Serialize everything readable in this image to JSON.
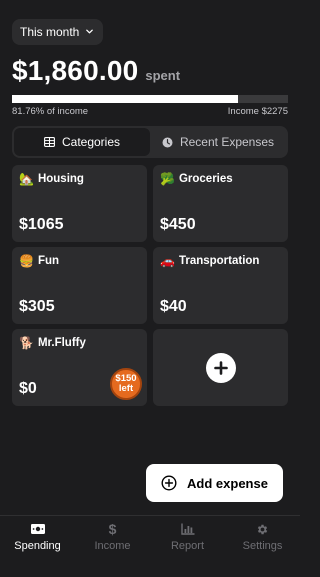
{
  "period": {
    "label": "This month",
    "icon": "chevron-down-icon"
  },
  "summary": {
    "amount": "$1,860.00",
    "spent_label": "spent",
    "progress": 0.8176,
    "percent_of_income": "81.76% of income",
    "income": "Income $2275"
  },
  "tabs": [
    {
      "label": "Categories",
      "icon": "table-icon",
      "active": true
    },
    {
      "label": "Recent Expenses",
      "icon": "clock-icon",
      "active": false
    }
  ],
  "categories": [
    {
      "emoji": "🏡",
      "name": "Housing",
      "amount": "$1065"
    },
    {
      "emoji": "🥦",
      "name": "Groceries",
      "amount": "$450"
    },
    {
      "emoji": "🍔",
      "name": "Fun",
      "amount": "$305"
    },
    {
      "emoji": "🚗",
      "name": "Transportation",
      "amount": "$40"
    },
    {
      "emoji": "🐕",
      "name": "Mr.Fluffy",
      "amount": "$0",
      "badge_amount": "$150",
      "badge_label": "left"
    }
  ],
  "add_category_icon": "plus-icon",
  "add_expense": {
    "label": "Add expense",
    "icon": "plus-circle-icon"
  },
  "nav": [
    {
      "label": "Spending",
      "icon": "banknote-icon",
      "active": true
    },
    {
      "label": "Income",
      "icon": "dollar-icon",
      "active": false
    },
    {
      "label": "Report",
      "icon": "bar-chart-icon",
      "active": false
    },
    {
      "label": "Settings",
      "icon": "gear-icon",
      "active": false
    }
  ],
  "colors": {
    "background": "#1c1c1e",
    "card": "#2c2c2e",
    "badge": "#e56a1f"
  }
}
